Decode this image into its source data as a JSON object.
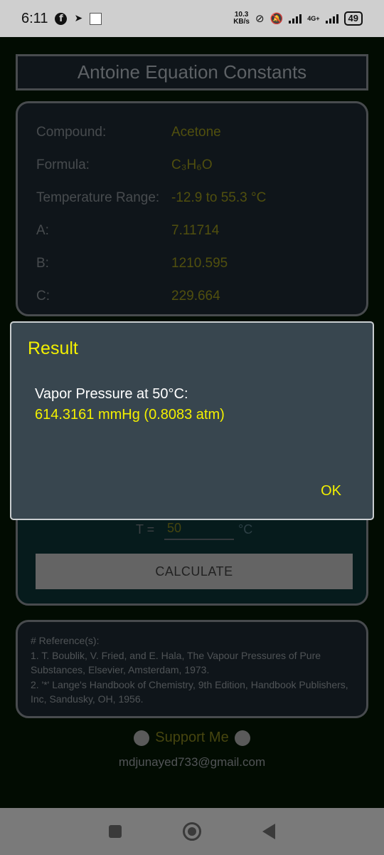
{
  "status_bar": {
    "time": "6:11",
    "speed_value": "10.3",
    "speed_unit": "KB/s",
    "network": "4G+",
    "battery": "49"
  },
  "app": {
    "title": "Antoine Equation Constants",
    "info": [
      {
        "label": "Compound:",
        "value": "Acetone"
      },
      {
        "label": "Formula:",
        "value": "C₃H₆O"
      },
      {
        "label": "Temperature Range:",
        "value": "-12.9 to 55.3 °C"
      },
      {
        "label": "A:",
        "value": "7.11714"
      },
      {
        "label": "B:",
        "value": "1210.595"
      },
      {
        "label": "C:",
        "value": "229.664"
      }
    ],
    "temperature": {
      "label": "T =",
      "value": "50",
      "unit": "°C"
    },
    "calculate_label": "CALCULATE",
    "references": {
      "heading": "# Reference(s):",
      "ref1": "1. T. Boublik, V. Fried, and E. Hala, The Vapour Pressures of Pure Substances, Elsevier, Amsterdam, 1973.",
      "ref2": "2. '*' Lange's Handbook of Chemistry, 9th Edition, Handbook Publishers, Inc, Sandusky, OH, 1956."
    },
    "support_label": "Support Me",
    "email": "mdjunayed733@gmail.com"
  },
  "dialog": {
    "title": "Result",
    "line1": "Vapor Pressure at 50°C:",
    "line2": "614.3161 mmHg (0.8083 atm)",
    "ok_label": "OK"
  },
  "colors": {
    "accent_yellow": "#f3f000",
    "dim_olive": "#7c7a16",
    "card_bg": "#182128",
    "dialog_bg": "#38464f"
  }
}
